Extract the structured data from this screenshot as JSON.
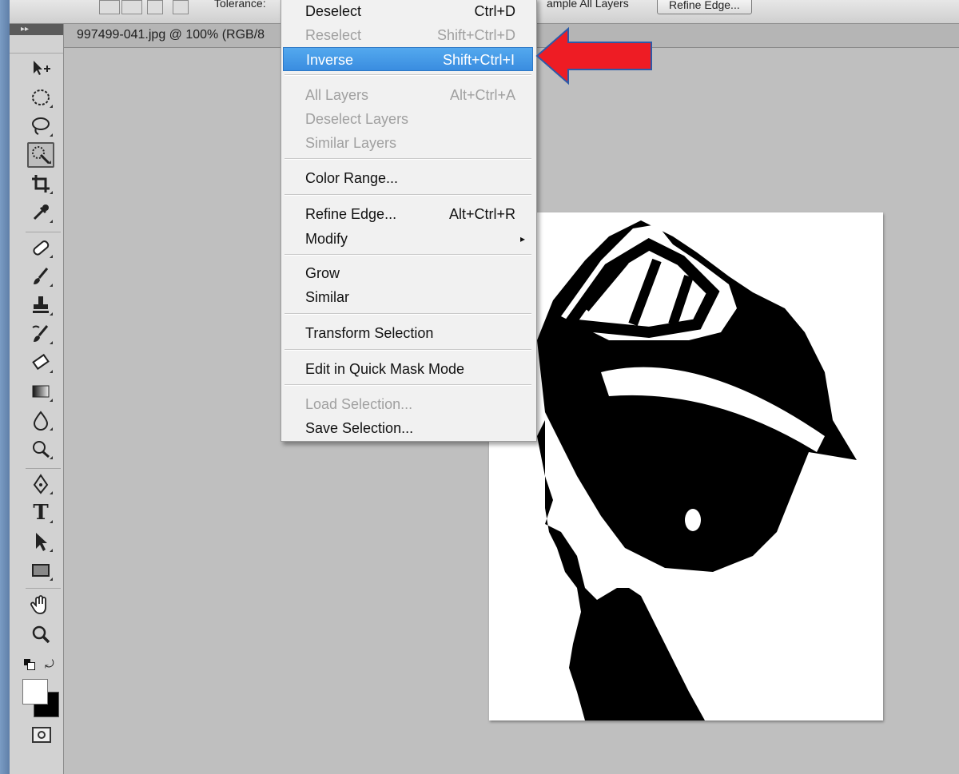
{
  "options_bar": {
    "tolerance_label": "Tolerance:",
    "sample_all_layers_label": "ample All Layers",
    "refine_edge_button": "Refine Edge..."
  },
  "document": {
    "tab_title": "997499-041.jpg @ 100% (RGB/8"
  },
  "toolbox": {
    "header": "▸▸",
    "tools": [
      "move-tool",
      "rectangular-marquee-tool",
      "lasso-tool",
      "quick-selection-tool",
      "crop-tool",
      "eyedropper-tool",
      "spot-healing-brush-tool",
      "brush-tool",
      "clone-stamp-tool",
      "history-brush-tool",
      "eraser-tool",
      "gradient-tool",
      "blur-tool",
      "dodge-tool",
      "pen-tool",
      "type-tool",
      "path-selection-tool",
      "rectangle-tool",
      "hand-tool",
      "zoom-tool"
    ],
    "type_tool_glyph": "T",
    "active_tool": "quick-selection-tool"
  },
  "select_menu": {
    "items": [
      {
        "label": "Deselect",
        "shortcut": "Ctrl+D",
        "enabled": true
      },
      {
        "label": "Reselect",
        "shortcut": "Shift+Ctrl+D",
        "enabled": false
      },
      {
        "label": "Inverse",
        "shortcut": "Shift+Ctrl+I",
        "enabled": true,
        "highlighted": true
      },
      {
        "label": "All Layers",
        "shortcut": "Alt+Ctrl+A",
        "enabled": false
      },
      {
        "label": "Deselect Layers",
        "shortcut": "",
        "enabled": false
      },
      {
        "label": "Similar Layers",
        "shortcut": "",
        "enabled": false
      },
      {
        "label": "Color Range...",
        "shortcut": "",
        "enabled": true
      },
      {
        "label": "Refine Edge...",
        "shortcut": "Alt+Ctrl+R",
        "enabled": true
      },
      {
        "label": "Modify",
        "shortcut": "",
        "enabled": true,
        "submenu": true
      },
      {
        "label": "Grow",
        "shortcut": "",
        "enabled": true
      },
      {
        "label": "Similar",
        "shortcut": "",
        "enabled": true
      },
      {
        "label": "Transform Selection",
        "shortcut": "",
        "enabled": true
      },
      {
        "label": "Edit in Quick Mask Mode",
        "shortcut": "",
        "enabled": true
      },
      {
        "label": "Load Selection...",
        "shortcut": "",
        "enabled": false
      },
      {
        "label": "Save Selection...",
        "shortcut": "",
        "enabled": true
      }
    ],
    "submenu_arrow": "▸"
  },
  "colors": {
    "highlight": "#3a8de0",
    "annotation_arrow": "#ee1c24"
  }
}
